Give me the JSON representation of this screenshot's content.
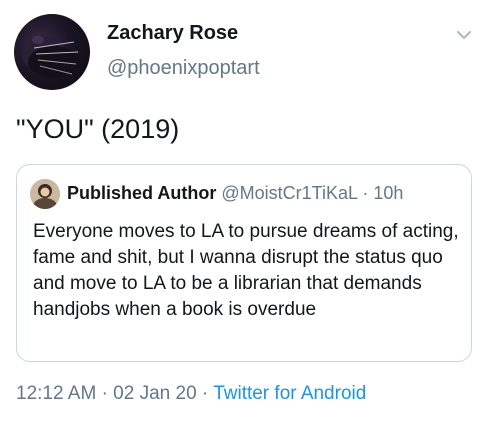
{
  "author": {
    "name": "Zachary Rose",
    "handle": "@phoenixpoptart"
  },
  "tweet": {
    "text": "\"YOU\" (2019)"
  },
  "quoted_tweet": {
    "author_name": "Published Author",
    "handle": "@MoistCr1TiKaL",
    "separator": "·",
    "time": "10h",
    "text": "Everyone moves to LA to pursue dreams of acting, fame and shit, but I wanna disrupt the status quo and move to LA to be a librarian that demands handjobs when a book is overdue"
  },
  "meta": {
    "time": "12:12 AM",
    "separator": "·",
    "date": "02 Jan 20",
    "separator2": "·",
    "source": "Twitter for Android"
  },
  "icons": {
    "menu": "chevron-down-icon"
  },
  "colors": {
    "text": "#14171a",
    "secondary": "#657786",
    "link": "#1b95e0",
    "border": "#ccd6dd"
  }
}
